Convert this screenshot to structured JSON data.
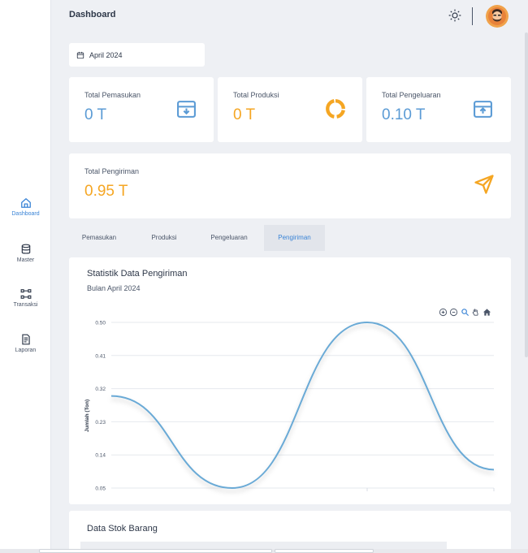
{
  "sidebar": {
    "items": [
      {
        "label": "Dashboard",
        "icon": "home-icon"
      },
      {
        "label": "Master",
        "icon": "database-icon"
      },
      {
        "label": "Transaksi",
        "icon": "transaction-icon"
      },
      {
        "label": "Laporan",
        "icon": "report-icon"
      }
    ]
  },
  "header": {
    "title": "Dashboard",
    "theme_icon": "sun-icon",
    "avatar_icon": "avatar-icon"
  },
  "date_picker": {
    "value": "April 2024",
    "icon": "calendar-icon"
  },
  "cards": [
    {
      "label": "Total Pemasukan",
      "value": "0 T",
      "color": "#5b9bd5",
      "icon": "inbox-download-icon"
    },
    {
      "label": "Total Produksi",
      "value": "0 T",
      "color": "#f5a623",
      "icon": "donut-chart-icon"
    },
    {
      "label": "Total Pengeluaran",
      "value": "0.10 T",
      "color": "#5b9bd5",
      "icon": "inbox-upload-icon"
    },
    {
      "label": "Total Pengiriman",
      "value": "0.95 T",
      "color": "#f5a623",
      "icon": "send-icon"
    }
  ],
  "tabs": [
    {
      "label": "Pemasukan",
      "active": false
    },
    {
      "label": "Produksi",
      "active": false
    },
    {
      "label": "Pengeluaran",
      "active": false
    },
    {
      "label": "Pengiriman",
      "active": true
    }
  ],
  "chart_section": {
    "title": "Statistik Data Pengiriman",
    "subtitle": "Bulan April 2024",
    "toolbar": [
      "zoom-in-icon",
      "zoom-out-icon",
      "magnify-icon",
      "pan-hand-icon",
      "reset-home-icon"
    ]
  },
  "chart_data": {
    "type": "line",
    "curve": "smooth",
    "ylabel": "Jumlah (Ton)",
    "xlabel": "",
    "yticks": [
      "0.50",
      "0.41",
      "0.32",
      "0.23",
      "0.14",
      "0.05"
    ],
    "ylim": [
      0.05,
      0.5
    ],
    "grid": true,
    "series": [
      {
        "color": "#6aaad6",
        "values": [
          0.3,
          0.05,
          0.5,
          0.1
        ]
      }
    ]
  },
  "stock_section": {
    "title": "Data Stok Barang"
  },
  "colors": {
    "accent_blue": "#3a84d6",
    "value_blue": "#5b9bd5",
    "value_orange": "#f5a623",
    "line": "#6aaad6"
  }
}
